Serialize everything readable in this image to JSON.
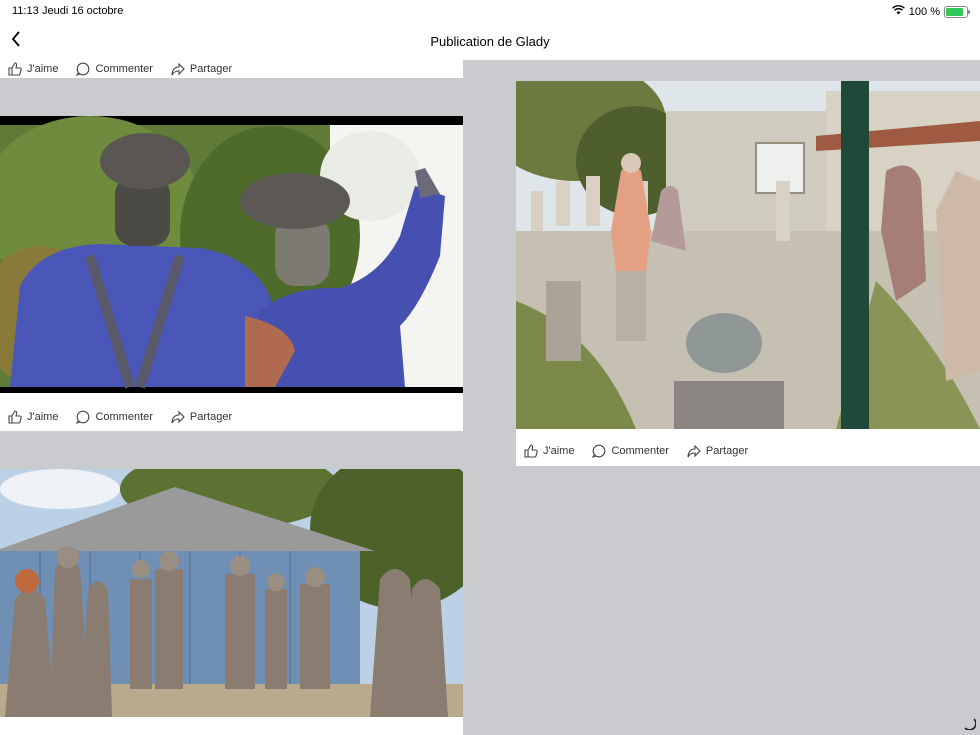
{
  "status": {
    "time": "11:13",
    "date": "Jeudi 16 octobre",
    "battery": "100 %"
  },
  "nav": {
    "title": "Publication de Glady",
    "back_icon": "chevron-left-icon"
  },
  "actions": {
    "like": "J'aime",
    "comment": "Commenter",
    "share": "Partager"
  },
  "colors": {
    "background": "#c9cbcf",
    "card": "#ffffff",
    "battery": "#34c759"
  },
  "posts": [
    {
      "image": "two statues with berets seen from behind, painted blue"
    },
    {
      "image": "courtyard filled with statues in front of a house"
    },
    {
      "image": "statues standing in front of a blue wooden shed"
    }
  ]
}
